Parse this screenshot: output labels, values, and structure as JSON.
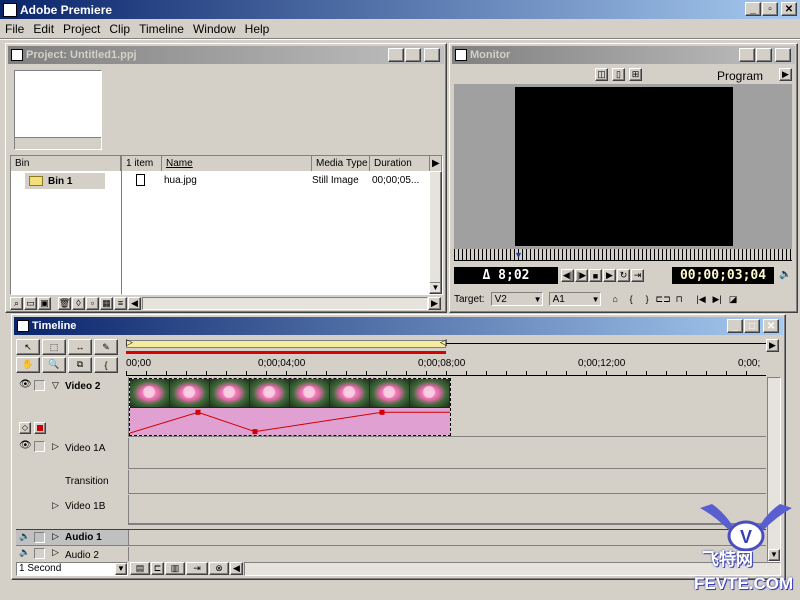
{
  "app": {
    "title": "Adobe Premiere"
  },
  "menu": [
    "File",
    "Edit",
    "Project",
    "Clip",
    "Timeline",
    "Window",
    "Help"
  ],
  "project": {
    "title": "Project: Untitled1.ppj",
    "bin_header": "Bin",
    "bin_name": "Bin 1",
    "count_header": "1 item",
    "columns": [
      "Name",
      "Media Type",
      "Duration"
    ],
    "items": [
      {
        "name": "hua.jpg",
        "type": "Still Image",
        "duration": "00;00;05..."
      }
    ]
  },
  "monitor": {
    "title": "Monitor",
    "view_label": "Program",
    "delta_time": "Δ 8;02",
    "timecode": "00;00;03;04",
    "target_label": "Target:",
    "video_target": "V2",
    "audio_target": "A1"
  },
  "timeline": {
    "title": "Timeline",
    "ruler": [
      "00;00",
      "0;00;04;00",
      "0;00;08;00",
      "0;00;12;00",
      "0;00;"
    ],
    "tracks": {
      "video2": "Video 2",
      "video1a": "Video 1A",
      "transition": "Transition",
      "video1b": "Video 1B",
      "audio1": "Audio 1",
      "audio2": "Audio 2"
    },
    "time_unit": "1 Second",
    "clip_frames": 8,
    "opacity_keyframes": [
      0.0,
      0.9,
      0.06,
      0.9
    ]
  },
  "watermark": {
    "line1": "飞特网",
    "line2": "FEVTE.COM"
  },
  "colors": {
    "title_active": "#0a246a",
    "clip_pink": "#e1a0d2",
    "rubber_band": "#d00000",
    "workarea": "#f4eaa0"
  }
}
